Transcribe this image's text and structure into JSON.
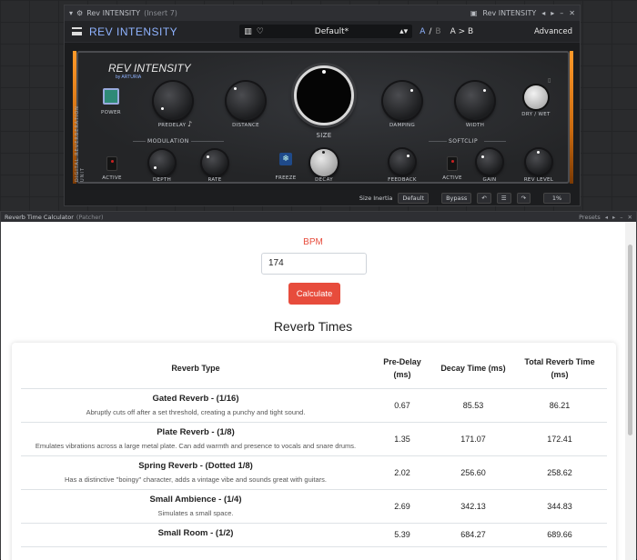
{
  "plugin_window": {
    "title": "Rev INTENSITY",
    "title_suffix": "(Insert 7)",
    "title_right": "Rev INTENSITY",
    "brand": "REV INTENSITY",
    "preset_name": "Default*",
    "ab_a": "A",
    "ab_sep": "/",
    "ab_b": "B",
    "ab_copy": "A > B",
    "advanced": "Advanced",
    "logo": "REV INTENSITY",
    "logo_sub": "by ARTURIA",
    "vertical_label": "DIGITAL REVERBERATION UNIT",
    "labels": {
      "power": "POWER",
      "predelay": "PREDELAY",
      "distance": "DISTANCE",
      "size": "SIZE",
      "damping": "DAMPING",
      "width": "WIDTH",
      "dry_wet": "DRY / WET",
      "modulation": "MODULATION",
      "active": "ACTIVE",
      "depth": "DEPTH",
      "rate": "RATE",
      "freeze": "FREEZE",
      "decay": "DECAY",
      "feedback": "FEEDBACK",
      "softclip": "SOFTCLIP",
      "active2": "ACTIVE",
      "gain": "GAIN",
      "rev_level": "REV LEVEL"
    },
    "footer": {
      "size_inertia": "Size Inertia",
      "size_inertia_value": "Default",
      "bypass": "Bypass",
      "zoom": "1%"
    }
  },
  "patcher": {
    "title": "Reverb Time Calculator",
    "subtitle": "(Patcher)",
    "presets": "Presets",
    "bpm_label": "BPM",
    "bpm_value": "174",
    "calculate": "Calculate",
    "heading": "Reverb Times",
    "columns": {
      "type": "Reverb Type",
      "predelay": "Pre-Delay (ms)",
      "decay": "Decay Time (ms)",
      "total": "Total Reverb Time (ms)"
    },
    "rows": [
      {
        "name": "Gated Reverb - (1/16)",
        "desc": "Abruptly cuts off after a set threshold, creating a punchy and tight sound.",
        "predelay": "0.67",
        "decay": "85.53",
        "total": "86.21"
      },
      {
        "name": "Plate Reverb - (1/8)",
        "desc": "Emulates vibrations across a large metal plate. Can add warmth and presence to vocals and snare drums.",
        "predelay": "1.35",
        "decay": "171.07",
        "total": "172.41"
      },
      {
        "name": "Spring Reverb - (Dotted 1/8)",
        "desc": "Has a distinctive \"boingy\" character, adds a vintage vibe and sounds great with guitars.",
        "predelay": "2.02",
        "decay": "256.60",
        "total": "258.62"
      },
      {
        "name": "Small Ambience - (1/4)",
        "desc": "Simulates a small space.",
        "predelay": "2.69",
        "decay": "342.13",
        "total": "344.83"
      },
      {
        "name": "Small Room - (1/2)",
        "desc": "",
        "predelay": "5.39",
        "decay": "684.27",
        "total": "689.66"
      }
    ]
  }
}
